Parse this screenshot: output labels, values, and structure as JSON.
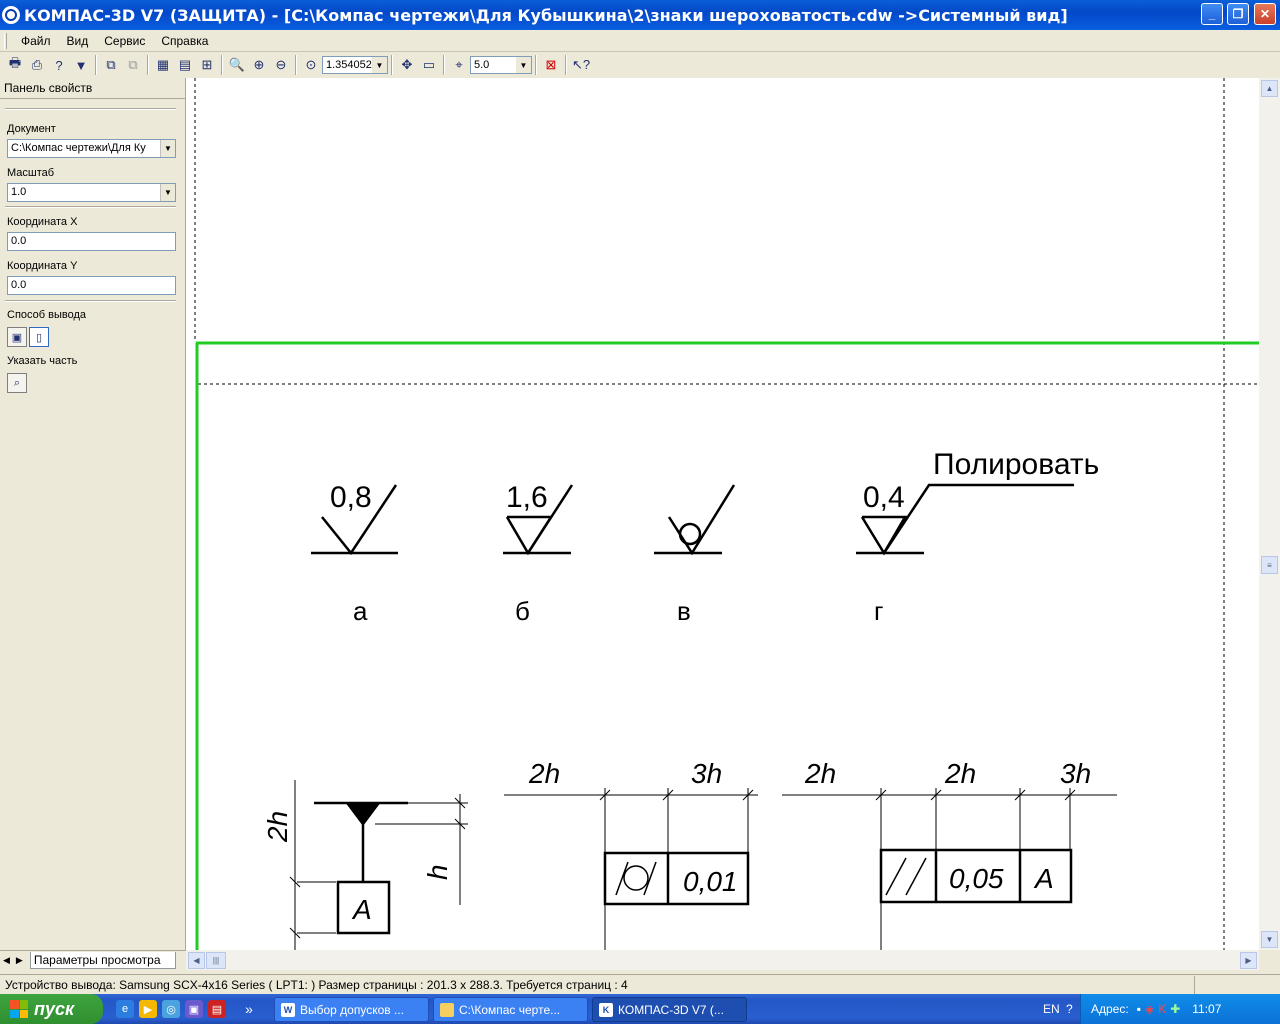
{
  "window": {
    "title": "КОМПАС-3D V7 (ЗАЩИТА) - [C:\\Компас чертежи\\Для Кубышкина\\2\\знаки шероховатость.cdw ->Системный вид]",
    "minimize": "_",
    "maximize": "❐",
    "close": "✕"
  },
  "menu": [
    "Файл",
    "Вид",
    "Сервис",
    "Справка"
  ],
  "toolbar": {
    "zoom_value": "1.354052",
    "step_value": "5.0"
  },
  "panel": {
    "header": "Панель свойств",
    "document_label": "Документ",
    "document_value": "C:\\Компас чертежи\\Для Ку",
    "scale_label": "Масштаб",
    "scale_value": "1.0",
    "coordx_label": "Координата X",
    "coordx_value": "0.0",
    "coordy_label": "Координата Y",
    "coordy_value": "0.0",
    "output_label": "Способ вывода",
    "part_label": "Указать часть",
    "tab_label": "Параметры просмотра"
  },
  "drawing": {
    "roughness": [
      {
        "value": "0,8",
        "caption": "а"
      },
      {
        "value": "1,6",
        "caption": "б"
      },
      {
        "value": "",
        "caption": "в"
      },
      {
        "value": "0,4",
        "caption": "г",
        "note": "Полировать"
      }
    ],
    "dims": {
      "h": "h",
      "two_h": "2h",
      "three_h": "3h",
      "datum": "A",
      "tol1": "0,01",
      "tol2": "0,05"
    }
  },
  "status": {
    "text": "Устройство вывода: Samsung SCX-4x16 Series ( LPT1: )  Размер страницы : 201.3 x 288.3.  Требуется страниц : 4"
  },
  "taskbar": {
    "start": "пуск",
    "tasks": [
      "Выбор допусков ...",
      "C:\\Компас черте...",
      "КОМПАС-3D V7 (..."
    ],
    "lang": "EN",
    "address": "Адрес:",
    "time": "11:07"
  }
}
